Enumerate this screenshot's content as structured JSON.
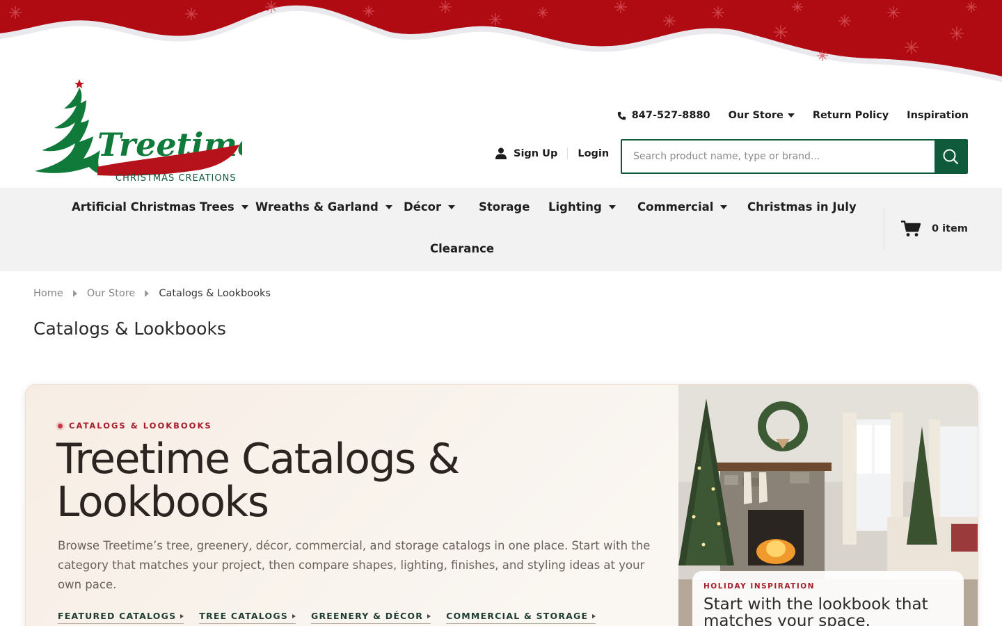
{
  "brand": {
    "logo_wordmark": "Treetime",
    "logo_tagline": "CHRISTMAS CREATIONS"
  },
  "utility_nav": {
    "phone": "847-527-8880",
    "our_store": "Our Store",
    "return_policy": "Return Policy",
    "inspiration": "Inspiration"
  },
  "account": {
    "sign_up": "Sign Up",
    "login": "Login"
  },
  "search": {
    "placeholder": "Search product name, type or brand..."
  },
  "main_nav": {
    "items": [
      {
        "label": "Artificial Christmas Trees",
        "has_dropdown": true
      },
      {
        "label": "Wreaths & Garland",
        "has_dropdown": true
      },
      {
        "label": "Décor",
        "has_dropdown": true
      },
      {
        "label": "Storage",
        "has_dropdown": false
      },
      {
        "label": "Lighting",
        "has_dropdown": true
      },
      {
        "label": "Commercial",
        "has_dropdown": true
      },
      {
        "label": "Christmas in July",
        "has_dropdown": false
      },
      {
        "label": "Clearance",
        "has_dropdown": false
      }
    ],
    "cart": {
      "count": "0",
      "label": "item"
    }
  },
  "breadcrumb": {
    "items": [
      "Home",
      "Our Store",
      "Catalogs & Lookbooks"
    ]
  },
  "page_title": "Catalogs & Lookbooks",
  "hero": {
    "eyebrow": "CATALOGS & LOOKBOOKS",
    "title": "Treetime Catalogs & Lookbooks",
    "text": "Browse Treetime’s tree, greenery, décor, commercial, and storage catalogs in one place. Start with the category that matches your project, then compare shapes, lighting, finishes, and styling ideas at your own pace.",
    "links": [
      "FEATURED CATALOGS",
      "TREE CATALOGS",
      "GREENERY & DÉCOR",
      "COMMERCIAL & STORAGE"
    ],
    "card": {
      "eyebrow": "HOLIDAY INSPIRATION",
      "title": "Start with the lookbook that matches your space."
    }
  },
  "colors": {
    "brand_green": "#0f5a3b",
    "brand_red": "#b5121b",
    "nav_bg": "#f2f2f2",
    "accent_red": "#a61e2a"
  }
}
